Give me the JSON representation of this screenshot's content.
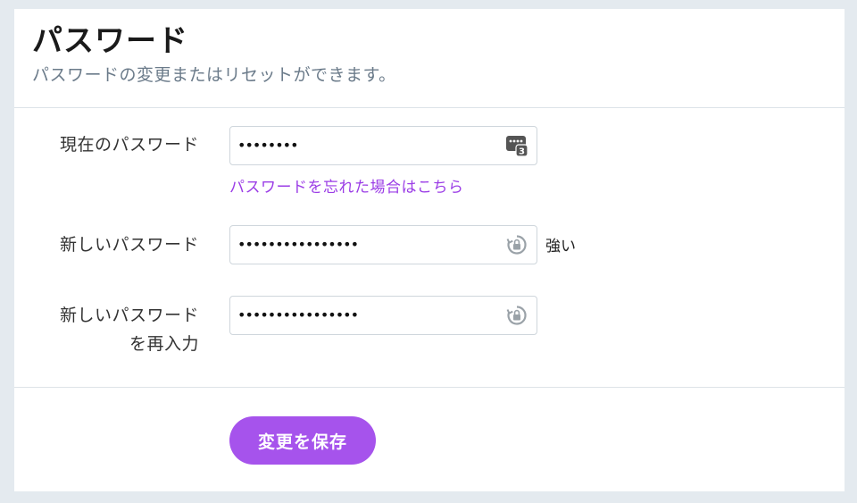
{
  "header": {
    "title": "パスワード",
    "subtitle": "パスワードの変更またはリセットができます。"
  },
  "form": {
    "current_password": {
      "label": "現在のパスワード",
      "masked_value": "••••••••",
      "icon": "password-manager-icon",
      "badge": "3"
    },
    "forgot_link": "パスワードを忘れた場合はこちら",
    "new_password": {
      "label": "新しいパスワード",
      "masked_value": "••••••••••••••••",
      "icon": "lock-refresh-icon",
      "strength": "強い"
    },
    "confirm_password": {
      "label_line1": "新しいパスワード",
      "label_line2": "を再入力",
      "masked_value": "••••••••••••••••",
      "icon": "lock-refresh-icon"
    }
  },
  "actions": {
    "save_label": "変更を保存"
  },
  "colors": {
    "accent": "#a653ec",
    "link": "#9b3de6",
    "background": "#e4eaef"
  }
}
